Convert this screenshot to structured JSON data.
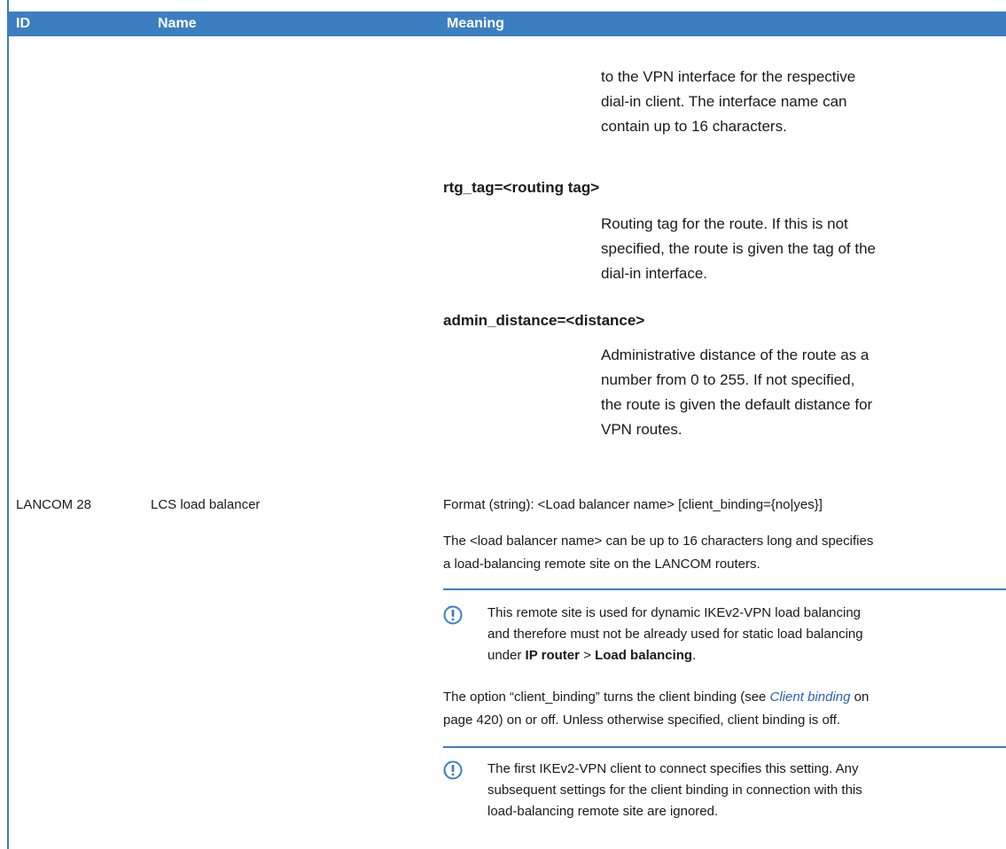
{
  "header": {
    "col_id": "ID",
    "col_name": "Name",
    "col_meaning": "Meaning"
  },
  "prev_row": {
    "continuation_lines": [
      "to the VPN interface for the respective",
      "dial-in client. The interface name can",
      "contain up to 16 characters."
    ],
    "param_rtg": "rtg_tag=<routing tag>",
    "rtg_lines": [
      "Routing tag for the route. If this is not",
      "specified, the route is given the tag of the",
      "dial-in interface."
    ],
    "param_admin": "admin_distance=<distance>",
    "admin_lines": [
      "Administrative distance of the route as a",
      "number from 0 to 255. If not specified,",
      "the route is given the default distance for",
      "VPN routes."
    ]
  },
  "row": {
    "id": "LANCOM 28",
    "name": "LCS load balancer",
    "format": "Format (string): <Load balancer name> [client_binding={no|yes}]",
    "desc_line1": "The <load balancer name> can be up to 16 characters long and specifies",
    "desc_line2": "a load-balancing remote site on the LANCOM routers.",
    "note1_line1": "This remote site is used for dynamic IKEv2-VPN load balancing",
    "note1_line2": "and therefore must not be already used for static load balancing",
    "note1_under": "under ",
    "note1_ip_router": "IP router",
    "note1_sep": " > ",
    "note1_load_balancing": "Load balancing",
    "note1_end": ".",
    "option_pre": "The option “client_binding” turns the client binding (see ",
    "option_link": "Client binding",
    "option_post": " on",
    "option_line2": "page 420) on or off. Unless otherwise specified, client binding is off.",
    "note2_line1": "The first IKEv2-VPN client to connect specifies this setting. Any",
    "note2_line2": "subsequent settings for the client binding in connection with this",
    "note2_line3": "load-balancing remote site are ignored."
  },
  "colors": {
    "accent": "#3c7fc1",
    "link": "#2a62b8"
  },
  "icons": {
    "note": "exclamation-circle-icon"
  }
}
